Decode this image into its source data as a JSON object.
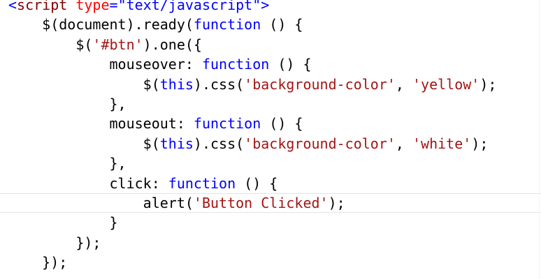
{
  "editor": {
    "lines": [
      {
        "tokens": [
          {
            "t": "<",
            "k": "punc"
          },
          {
            "t": "script",
            "k": "tag"
          },
          {
            "t": " ",
            "k": "plain"
          },
          {
            "t": "type",
            "k": "attr"
          },
          {
            "t": "=",
            "k": "punc"
          },
          {
            "t": "\"text/javascript\"",
            "k": "kw"
          },
          {
            "t": ">",
            "k": "punc"
          }
        ]
      },
      {
        "tokens": [
          {
            "t": "    $(document).ready(",
            "k": "plain"
          },
          {
            "t": "function",
            "k": "kw"
          },
          {
            "t": " () {",
            "k": "plain"
          }
        ]
      },
      {
        "tokens": [
          {
            "t": "        $(",
            "k": "plain"
          },
          {
            "t": "'#btn'",
            "k": "str"
          },
          {
            "t": ").one({",
            "k": "plain"
          }
        ]
      },
      {
        "tokens": [
          {
            "t": "            mouseover: ",
            "k": "plain"
          },
          {
            "t": "function",
            "k": "kw"
          },
          {
            "t": " () {",
            "k": "plain"
          }
        ]
      },
      {
        "tokens": [
          {
            "t": "                $(",
            "k": "plain"
          },
          {
            "t": "this",
            "k": "kw"
          },
          {
            "t": ").css(",
            "k": "plain"
          },
          {
            "t": "'background-color'",
            "k": "str"
          },
          {
            "t": ", ",
            "k": "plain"
          },
          {
            "t": "'yellow'",
            "k": "str"
          },
          {
            "t": ");",
            "k": "plain"
          }
        ]
      },
      {
        "tokens": [
          {
            "t": "            },",
            "k": "plain"
          }
        ]
      },
      {
        "tokens": [
          {
            "t": "            mouseout: ",
            "k": "plain"
          },
          {
            "t": "function",
            "k": "kw"
          },
          {
            "t": " () {",
            "k": "plain"
          }
        ]
      },
      {
        "tokens": [
          {
            "t": "                $(",
            "k": "plain"
          },
          {
            "t": "this",
            "k": "kw"
          },
          {
            "t": ").css(",
            "k": "plain"
          },
          {
            "t": "'background-color'",
            "k": "str"
          },
          {
            "t": ", ",
            "k": "plain"
          },
          {
            "t": "'white'",
            "k": "str"
          },
          {
            "t": ");",
            "k": "plain"
          }
        ]
      },
      {
        "tokens": [
          {
            "t": "            },",
            "k": "plain"
          }
        ]
      },
      {
        "tokens": [
          {
            "t": "            click: ",
            "k": "plain"
          },
          {
            "t": "function",
            "k": "kw"
          },
          {
            "t": " () {",
            "k": "plain"
          }
        ]
      },
      {
        "current": true,
        "tokens": [
          {
            "t": "                alert(",
            "k": "plain"
          },
          {
            "t": "'Button Clicked'",
            "k": "str"
          },
          {
            "t": ");",
            "k": "plain"
          }
        ]
      },
      {
        "tokens": [
          {
            "t": "            }",
            "k": "plain"
          }
        ]
      },
      {
        "tokens": [
          {
            "t": "        });",
            "k": "plain"
          }
        ]
      },
      {
        "tokens": [
          {
            "t": "    });",
            "k": "plain"
          }
        ]
      }
    ]
  },
  "colors": {
    "background": "#ffffff",
    "keyword": "#0000ff",
    "string": "#a31515",
    "tag": "#800000",
    "attribute": "#ff0000",
    "plain": "#000000"
  }
}
